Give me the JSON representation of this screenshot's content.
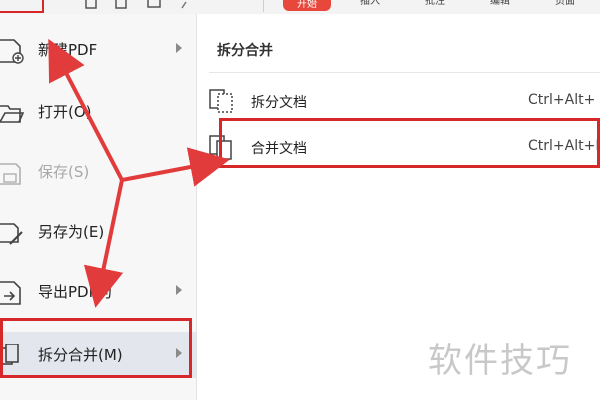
{
  "toolbar": {
    "tabs": [
      {
        "label": "开始",
        "active": true
      },
      {
        "label": "插入"
      },
      {
        "label": "批注"
      },
      {
        "label": "编辑"
      },
      {
        "label": "页面"
      }
    ]
  },
  "file_menu": {
    "items": [
      {
        "label": "新建PDF",
        "icon": "new-pdf-icon",
        "has_submenu": true
      },
      {
        "label": "打开(O)",
        "icon": "folder-open-icon"
      },
      {
        "label": "保存(S)",
        "icon": "save-icon",
        "disabled": true
      },
      {
        "label": "另存为(E)",
        "icon": "save-as-icon"
      },
      {
        "label": "导出PDF为",
        "icon": "export-icon",
        "has_submenu": true
      },
      {
        "label": "拆分合并(M)",
        "icon": "split-merge-icon",
        "has_submenu": true,
        "active": true
      }
    ]
  },
  "submenu": {
    "title": "拆分合并",
    "items": [
      {
        "label": "拆分文档",
        "shortcut": "Ctrl+Alt+",
        "icon": "split-doc-icon"
      },
      {
        "label": "合并文档",
        "shortcut": "Ctrl+Alt+I",
        "icon": "merge-doc-icon"
      }
    ]
  },
  "watermark": "软件技巧",
  "colors": {
    "highlight": "#d62828",
    "accent_tab": "#e8483b",
    "menu_bg": "#f7f7f7",
    "active_bg": "#e3e6ec"
  }
}
